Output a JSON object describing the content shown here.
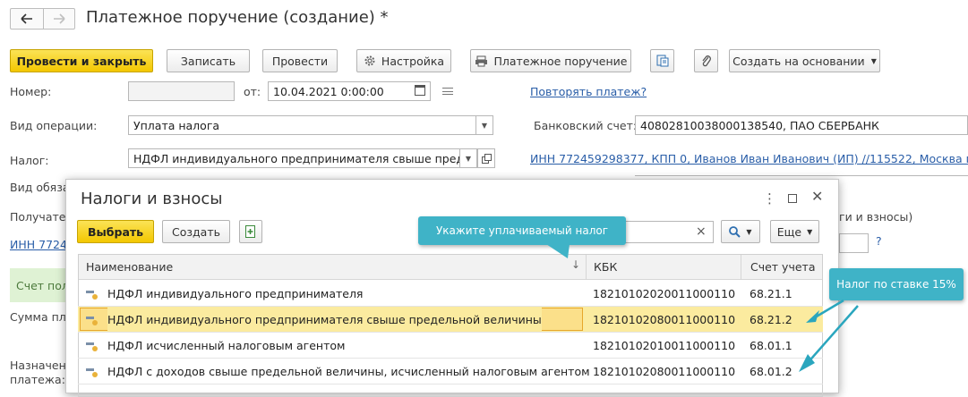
{
  "window": {
    "title": "Платежное поручение (создание) *"
  },
  "toolbar": {
    "post_close": "Провести и закрыть",
    "save": "Записать",
    "post": "Провести",
    "settings": "Настройка",
    "payment_order": "Платежное поручение",
    "create_based": "Создать на основании"
  },
  "form": {
    "number_label": "Номер:",
    "number_value": "",
    "from_label": "от:",
    "date_value": "10.04.2021  0:00:00",
    "repeat_link": "Повторять платеж?",
    "op_label": "Вид операции:",
    "op_value": "Уплата налога",
    "bank_label": "Банковский счет:",
    "bank_value": "40802810038000138540, ПАО СБЕРБАНК",
    "tax_label": "Налог:",
    "tax_value": "НДФЛ индивидуального предпринимателя свыше преде",
    "inn_link": "ИНН 772459298377, КПП 0, Иванов Иван Иванович (ИП) //115522, Москва г, м",
    "obl_label": "Вид обяза",
    "recipient_label": "Получате",
    "recipient_inn": "ИНН 7724",
    "taxes_tail": "ги и взносы)",
    "question": "?",
    "account_paid": "Счет пол",
    "sum_label": "Сумма пл",
    "purpose_label_1": "Назначен",
    "purpose_label_2": "платежа:"
  },
  "modal": {
    "title": "Налоги и взносы",
    "select": "Выбрать",
    "create": "Создать",
    "more": "Еще",
    "clear": "×",
    "columns": [
      "Наименование",
      "КБК",
      "Счет учета"
    ],
    "rows": [
      {
        "name": "НДФЛ индивидуального предпринимателя",
        "kbk": "18210102020011000110",
        "account": "68.21.1"
      },
      {
        "name": "НДФЛ индивидуального предпринимателя свыше предельной величины",
        "kbk": "18210102080011000110",
        "account": "68.21.2",
        "selected": true
      },
      {
        "name": "НДФЛ исчисленный налоговым агентом",
        "kbk": "18210102010011000110",
        "account": "68.01.1"
      },
      {
        "name": "НДФЛ с доходов свыше предельной величины, исчисленный налоговым агентом",
        "kbk": "18210102080011000110",
        "account": "68.01.2"
      }
    ]
  },
  "callouts": {
    "choose_tax": "Укажите уплачиваемый налог",
    "rate_15": "Налог по ставке 15%"
  },
  "colors": {
    "primary": "#f5cf1f",
    "link": "#2a5ea8",
    "callout": "#3fb3c7",
    "selected_row": "#fbeb9f"
  }
}
